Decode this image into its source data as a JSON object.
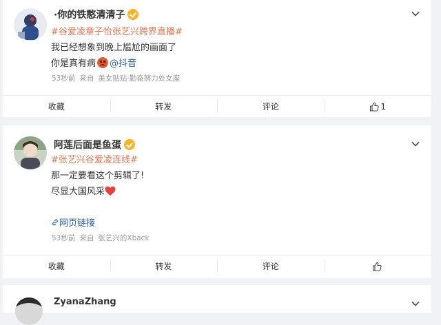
{
  "posts": [
    {
      "author": "·你的铁憨清清子",
      "text_lines": [
        {
          "tag": "#谷爱凌章子怡张艺兴跨界直播#"
        },
        {
          "text": "我已经想象到晚上尴尬的画面了"
        },
        {
          "text": "你是真有病",
          "mention": "@抖音"
        }
      ],
      "time": "53秒前",
      "source_prefix": "来自",
      "source": "美女贴贴·勤奋努力处女座",
      "actions": {
        "favorite": "收藏",
        "repost": "转发",
        "comment": "评论",
        "like_count": "1"
      }
    },
    {
      "author": "阿莲后面是鱼蛋",
      "text_lines": [
        {
          "tag": "#张艺兴谷爱凌连线#"
        },
        {
          "text": "那一定要看这个剪辑了!"
        },
        {
          "text": "尽显大国风采"
        }
      ],
      "web_link": "网页链接",
      "time": "53秒前",
      "source_prefix": "来自",
      "source": "张艺兴的Xback",
      "actions": {
        "favorite": "收藏",
        "repost": "转发",
        "comment": "评论",
        "like_count": ""
      }
    },
    {
      "author": "ZyanaZhang"
    }
  ],
  "colors": {
    "tag": "#eb7350",
    "link": "#2a5fb0",
    "badge": "#f6b52b",
    "heart": "#e8403a"
  },
  "icons": [
    "verified-badge-icon",
    "chevron-down-icon",
    "thumb-up-icon",
    "link-icon",
    "heart-emoji",
    "angry-emoji"
  ]
}
